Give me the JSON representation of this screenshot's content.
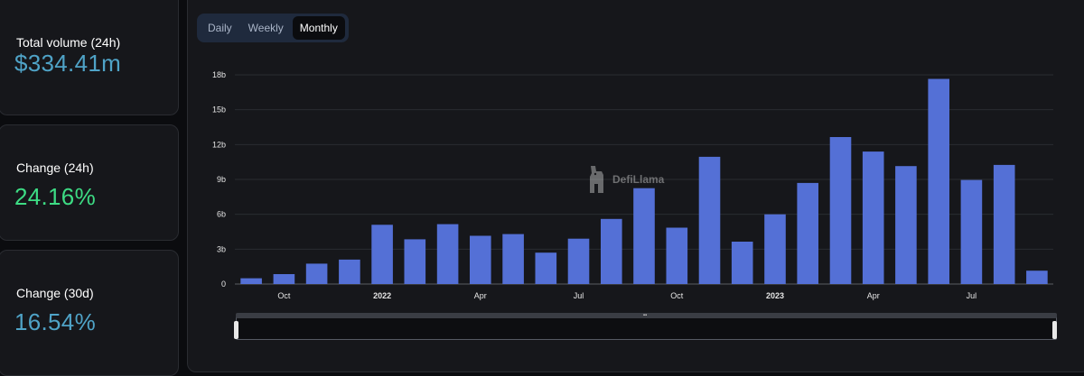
{
  "stats": {
    "volume": {
      "label": "Total volume (24h)",
      "value": "$334.41m",
      "color": "#4fa3c7"
    },
    "change24": {
      "label": "Change (24h)",
      "value": "24.16%",
      "color": "#3ddc84"
    },
    "change30": {
      "label": "Change (30d)",
      "value": "16.54%",
      "color": "#4fa3c7"
    }
  },
  "tabs": [
    "Daily",
    "Weekly",
    "Monthly"
  ],
  "active_tab": "Monthly",
  "watermark": "DefiLlama",
  "chart_data": {
    "type": "bar",
    "bar_color": "#5470d6",
    "y_ticks": [
      "0",
      "3b",
      "6b",
      "9b",
      "12b",
      "15b",
      "18b"
    ],
    "ylim": [
      0,
      18
    ],
    "x_ticks": [
      {
        "label": "Oct",
        "index": 1,
        "bold": false
      },
      {
        "label": "2022",
        "index": 4,
        "bold": true
      },
      {
        "label": "Apr",
        "index": 7,
        "bold": false
      },
      {
        "label": "Jul",
        "index": 10,
        "bold": false
      },
      {
        "label": "Oct",
        "index": 13,
        "bold": false
      },
      {
        "label": "2023",
        "index": 16,
        "bold": true
      },
      {
        "label": "Apr",
        "index": 19,
        "bold": false
      },
      {
        "label": "Jul",
        "index": 22,
        "bold": false
      }
    ],
    "categories": [
      "2021-09",
      "2021-10",
      "2021-11",
      "2021-12",
      "2022-01",
      "2022-02",
      "2022-03",
      "2022-04",
      "2022-05",
      "2022-06",
      "2022-07",
      "2022-08",
      "2022-09",
      "2022-10",
      "2022-11",
      "2022-12",
      "2023-01",
      "2023-02",
      "2023-03",
      "2023-04",
      "2023-05",
      "2023-06",
      "2023-07",
      "2023-08",
      "2023-09"
    ],
    "values": [
      0.5,
      0.85,
      1.75,
      2.1,
      5.1,
      3.85,
      5.15,
      4.15,
      4.3,
      2.7,
      3.9,
      5.6,
      8.25,
      4.85,
      10.95,
      3.65,
      6.0,
      8.7,
      12.65,
      11.4,
      10.15,
      17.65,
      8.95,
      10.25,
      1.15
    ]
  }
}
